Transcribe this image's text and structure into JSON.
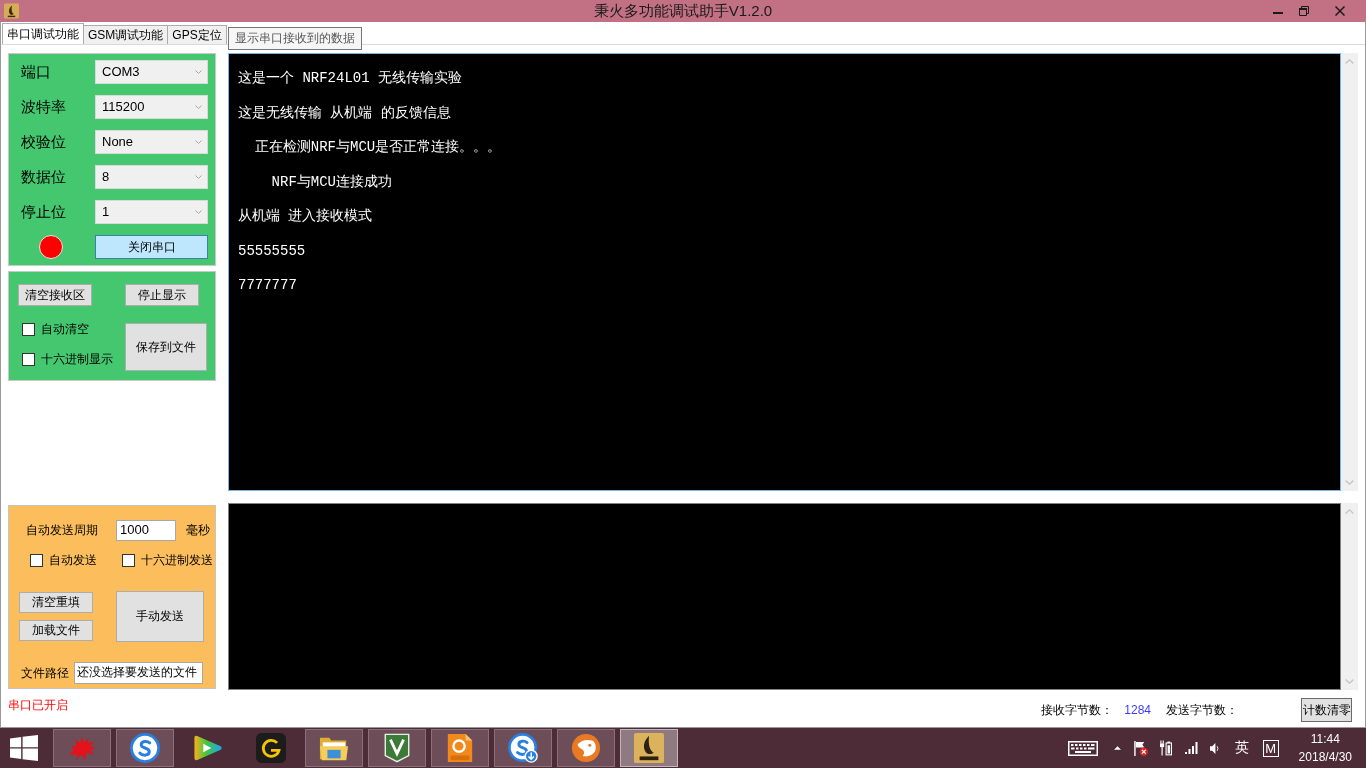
{
  "window": {
    "title": "秉火多功能调试助手V1.2.0"
  },
  "tabs": [
    {
      "label": "串口调试功能",
      "selected": true
    },
    {
      "label": "GSM调试功能",
      "selected": false
    },
    {
      "label": "GPS定位",
      "selected": false
    }
  ],
  "tooltip": {
    "text": "显示串口接收到的数据"
  },
  "serial_settings": {
    "fields": [
      {
        "label": "端口",
        "value": "COM3"
      },
      {
        "label": "波特率",
        "value": "115200"
      },
      {
        "label": "校验位",
        "value": "None"
      },
      {
        "label": "数据位",
        "value": "8"
      },
      {
        "label": "停止位",
        "value": "1"
      }
    ],
    "indicator": {
      "on": true
    },
    "toggle_button": "关闭串口"
  },
  "receive_options": {
    "clear_button": "清空接收区",
    "pause_button": "停止显示",
    "checkboxes": [
      {
        "label": "自动清空",
        "checked": false
      },
      {
        "label": "十六进制显示",
        "checked": false
      }
    ],
    "save_button": "保存到文件"
  },
  "receive_area": {
    "lines": [
      "这是一个 NRF24L01 无线传输实验",
      "这是无线传输 从机端 的反馈信息",
      "  正在检测NRF与MCU是否正常连接。。。",
      "    NRF与MCU连接成功",
      "从机端 进入接收模式",
      "55555555",
      "7777777"
    ]
  },
  "send_options": {
    "period_label": "自动发送周期",
    "period_value": "1000",
    "period_unit": "毫秒",
    "checkboxes": [
      {
        "label": "自动发送",
        "checked": false
      },
      {
        "label": "十六进制发送",
        "checked": false
      }
    ],
    "clear_button": "清空重填",
    "load_button": "加载文件",
    "send_button": "手动发送",
    "file_path_label": "文件路径",
    "file_path_value": "还没选择要发送的文件"
  },
  "status_bar": {
    "port_status": "串口已开启",
    "received_label": "接收字节数：",
    "received_count": "1284",
    "sent_label": "发送字节数：",
    "reset_button": "计数清零"
  },
  "taskbar": {
    "apps": [
      {
        "running": true,
        "selected": false
      },
      {
        "running": true,
        "selected": false
      },
      {
        "running": false,
        "selected": false
      },
      {
        "running": false,
        "selected": false
      },
      {
        "running": true,
        "selected": false
      },
      {
        "running": true,
        "selected": false
      },
      {
        "running": true,
        "selected": false
      },
      {
        "running": true,
        "selected": false
      },
      {
        "running": true,
        "selected": false
      },
      {
        "running": true,
        "selected": true
      }
    ],
    "tray": {
      "input_language": "英",
      "ime_mode": "M",
      "time": "11:44",
      "date": "2018/4/30"
    }
  }
}
